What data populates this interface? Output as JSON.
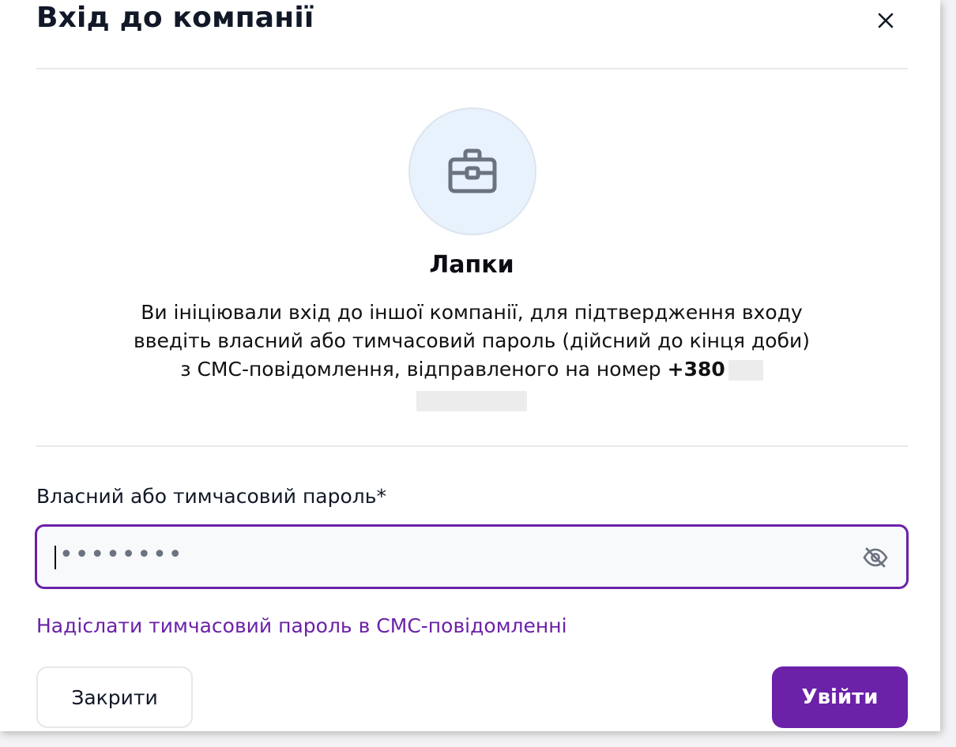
{
  "dialog": {
    "title": "Вхід до компанії",
    "close_icon": "close-icon"
  },
  "company": {
    "icon": "briefcase-icon",
    "name": "Лапки",
    "message_text": "Ви ініціювали вхід до іншої компанії, для підтвердження входу введіть власний або тимчасовий пароль (дійсний до кінця доби) з СМС-повідомлення, відправленого на номер",
    "phone_prefix": "+380"
  },
  "password_field": {
    "label": "Власний або тимчасовий пароль*",
    "masked_value": "••••••••",
    "toggle_icon": "eye-off-icon"
  },
  "sms_link": "Надіслати тимчасовий пароль в СМС-повідомленні",
  "buttons": {
    "close_label": "Закрити",
    "login_label": "Увійти"
  },
  "colors": {
    "accent": "#6b21a8",
    "circle_bg": "#e8f2fd",
    "icon": "#6b7280"
  }
}
